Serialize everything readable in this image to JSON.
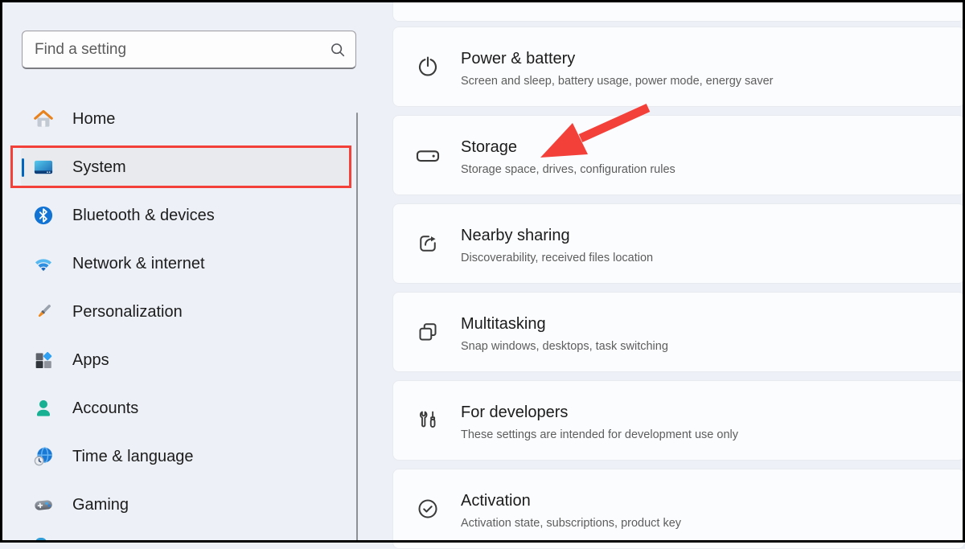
{
  "colors": {
    "accent": "#0067c0",
    "highlight_red": "#f3413a"
  },
  "search": {
    "placeholder": "Find a setting"
  },
  "sidebar": {
    "items": [
      {
        "label": "Home",
        "selected": false
      },
      {
        "label": "System",
        "selected": true
      },
      {
        "label": "Bluetooth & devices",
        "selected": false
      },
      {
        "label": "Network & internet",
        "selected": false
      },
      {
        "label": "Personalization",
        "selected": false
      },
      {
        "label": "Apps",
        "selected": false
      },
      {
        "label": "Accounts",
        "selected": false
      },
      {
        "label": "Time & language",
        "selected": false
      },
      {
        "label": "Gaming",
        "selected": false
      }
    ]
  },
  "main": {
    "cards": [
      {
        "title": "Power & battery",
        "subtitle": "Screen and sleep, battery usage, power mode, energy saver"
      },
      {
        "title": "Storage",
        "subtitle": "Storage space, drives, configuration rules"
      },
      {
        "title": "Nearby sharing",
        "subtitle": "Discoverability, received files location"
      },
      {
        "title": "Multitasking",
        "subtitle": "Snap windows, desktops, task switching"
      },
      {
        "title": "For developers",
        "subtitle": "These settings are intended for development use only"
      },
      {
        "title": "Activation",
        "subtitle": "Activation state, subscriptions, product key"
      }
    ]
  }
}
